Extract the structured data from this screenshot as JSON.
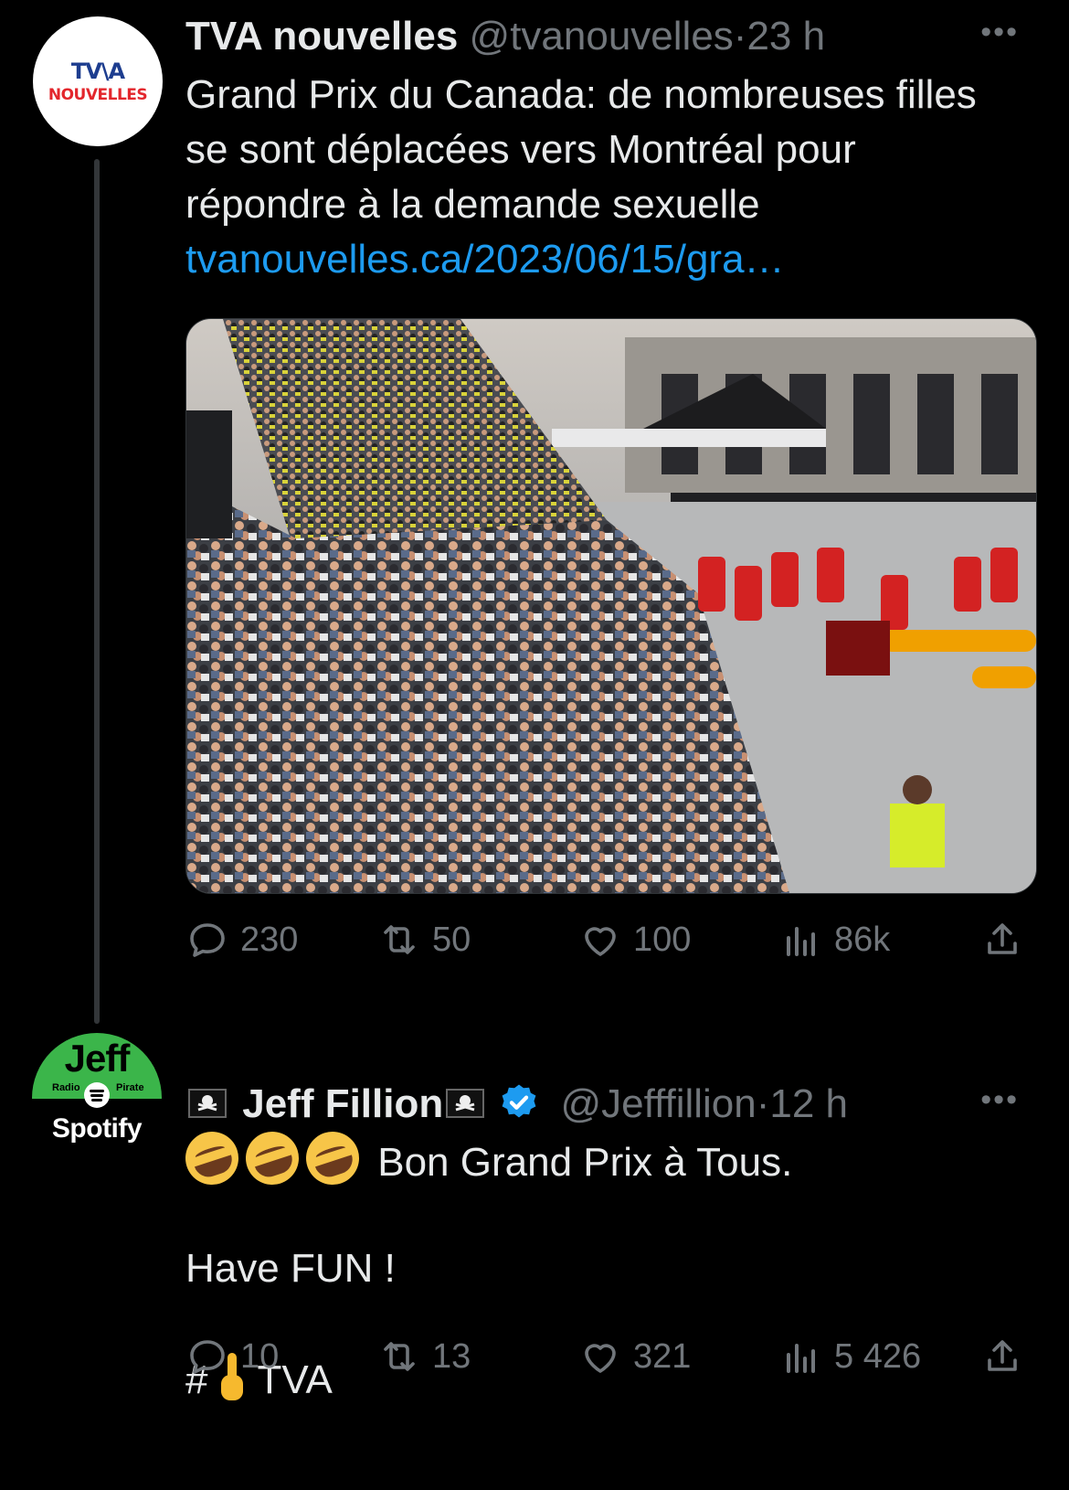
{
  "tweets": [
    {
      "author": "TVA nouvelles",
      "handle": "@tvanouvelles",
      "time": "23 h",
      "avatar": {
        "line1": "TV\\A",
        "line2": "NOUVELLES"
      },
      "text": "Grand Prix du Canada: de nombreuses filles se sont déplacées vers Montréal pour répondre à la demande sexuelle",
      "link": "tvanouvelles.ca/2023/06/15/gra…",
      "stats": {
        "replies": "230",
        "retweets": "50",
        "likes": "100",
        "views": "86k"
      }
    },
    {
      "author": "Jeff Fillion",
      "handle": "@Jefffillion",
      "time": "12 h",
      "avatar": {
        "word": "Jeff",
        "left": "Radio",
        "right": "Pirate",
        "brand": "Spotify"
      },
      "line1": "Bon Grand Prix à Tous.",
      "line2": "Have FUN !",
      "hash_prefix": "#",
      "hash_suffix": "TVA",
      "stats": {
        "replies": "10",
        "retweets": "13",
        "likes": "321",
        "views": "5 426"
      }
    }
  ],
  "colors": {
    "background": "#000000",
    "text": "#e7e9ea",
    "muted": "#71767b",
    "link": "#1d9bf0",
    "verified": "#1d9bf0"
  }
}
